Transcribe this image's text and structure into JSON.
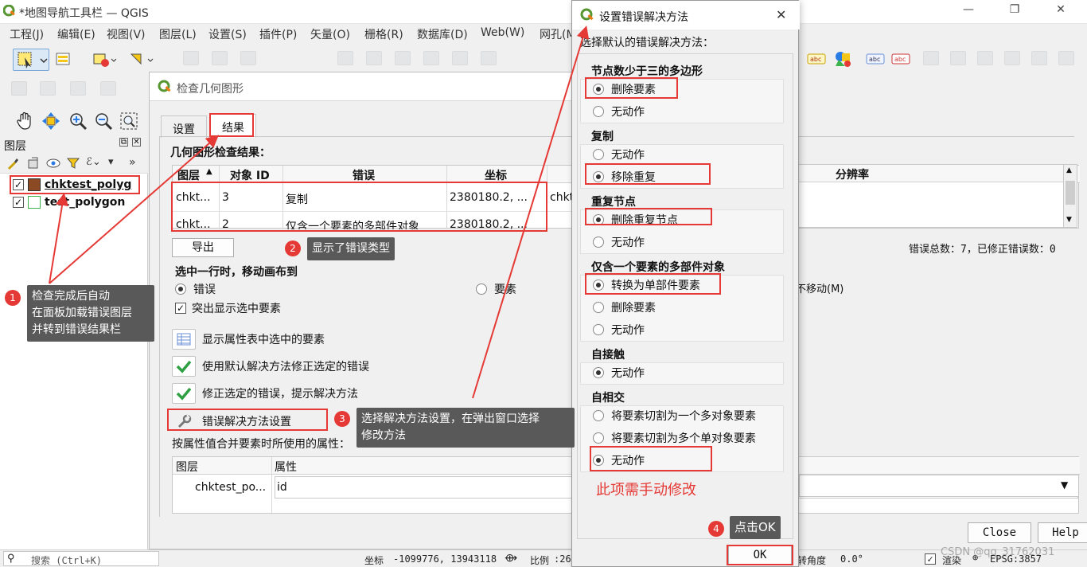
{
  "app": {
    "title": "*地图导航工具栏 — QGIS"
  },
  "menu": [
    "工程(J)",
    "编辑(E)",
    "视图(V)",
    "图层(L)",
    "设置(S)",
    "插件(P)",
    "矢量(O)",
    "栅格(R)",
    "数据库(D)",
    "Web(W)",
    "网孔(M)"
  ],
  "layers_panel": {
    "title": "图层",
    "layers": [
      {
        "name": "chktest_polyg",
        "checked": true,
        "color": "#8b4a24"
      },
      {
        "name": "test_polygon",
        "checked": true,
        "color": "#ffffff"
      }
    ]
  },
  "statusbar": {
    "search_placeholder": "搜索 (Ctrl+K)",
    "coord_label": "坐标",
    "coord_value": "-1099776, 13943118",
    "scale_label": "比例",
    "scale_value": ":26",
    "rotation_label": "转角度",
    "rotation_value": "0.0°",
    "render_label": "渲染",
    "crs": "EPSG:3857"
  },
  "geom_dialog": {
    "title": "检查几何图形",
    "tabs": [
      "设置",
      "结果"
    ],
    "results_label": "几何图形检查结果：",
    "columns": [
      "图层",
      "对象 ID",
      "错误",
      "坐标",
      "分辨率"
    ],
    "rows": [
      {
        "layer": "chkt...",
        "id": "3",
        "error": "复制",
        "coord": "2380180.2, ...",
        "extra": "chkt"
      },
      {
        "layer": "chkt...",
        "id": "2",
        "error": "仅含一个要素的多部件对象",
        "coord": "2380180.2, ...",
        "extra": ""
      }
    ],
    "export_btn": "导出",
    "summary": "错误总数：7，已修正错误数：0",
    "move_label": "选中一行时，移动画布到",
    "move_options": [
      {
        "label": "错误",
        "selected": true
      },
      {
        "label": "要素",
        "selected": false
      },
      {
        "label": "不移动(M)",
        "selected": false
      }
    ],
    "highlight_label": "突出显示选中要素",
    "actions": [
      {
        "label": "显示属性表中选中的要素",
        "icon": "table-icon"
      },
      {
        "label": "使用默认解决方法修正选定的错误",
        "icon": "check-icon"
      },
      {
        "label": "修正选定的错误，提示解决方法",
        "icon": "check-icon"
      },
      {
        "label": "错误解决方法设置",
        "icon": "wrench-icon"
      }
    ],
    "merge_label": "按属性值合并要素时所使用的属性：",
    "merge_columns": [
      "图层",
      "属性"
    ],
    "merge_row": {
      "layer": "chktest_po...",
      "attr": "id"
    },
    "close_btn": "Close",
    "help_btn": "Help"
  },
  "res_dialog": {
    "title": "设置错误解决方法",
    "subtitle": "选择默认的错误解决方法：",
    "groups": [
      {
        "title": "节点数少于三的多边形",
        "options": [
          {
            "label": "删除要素",
            "selected": true
          },
          {
            "label": "无动作",
            "selected": false
          }
        ]
      },
      {
        "title": "复制",
        "options": [
          {
            "label": "无动作",
            "selected": false
          },
          {
            "label": "移除重复",
            "selected": true
          }
        ]
      },
      {
        "title": "重复节点",
        "options": [
          {
            "label": "删除重复节点",
            "selected": true
          },
          {
            "label": "无动作",
            "selected": false
          }
        ]
      },
      {
        "title": "仅含一个要素的多部件对象",
        "options": [
          {
            "label": "转换为单部件要素",
            "selected": true
          },
          {
            "label": "删除要素",
            "selected": false
          },
          {
            "label": "无动作",
            "selected": false
          }
        ]
      },
      {
        "title": "自接触",
        "options": [
          {
            "label": "无动作",
            "selected": true
          }
        ]
      },
      {
        "title": "自相交",
        "options": [
          {
            "label": "将要素切割为一个多对象要素",
            "selected": false
          },
          {
            "label": "将要素切割为多个单对象要素",
            "selected": false
          },
          {
            "label": "无动作",
            "selected": true
          }
        ]
      }
    ],
    "ok_btn": "OK"
  },
  "annotations": {
    "note1": [
      "检查完成后自动",
      "在面板加载错误图层",
      "并转到错误结果栏"
    ],
    "note2": "显示了错误类型",
    "note3": [
      "选择解决方法设置，在弹出窗口选择",
      "修改方法"
    ],
    "note4": "点击OK",
    "manual_note": "此项需手动修改",
    "badges": [
      "1",
      "2",
      "3",
      "4"
    ],
    "watermark": "CSDN @qq_31762031"
  },
  "colors": {
    "annotation_red": "#e53935",
    "tip_bg": "#595959",
    "qgis_green": "#589632"
  }
}
